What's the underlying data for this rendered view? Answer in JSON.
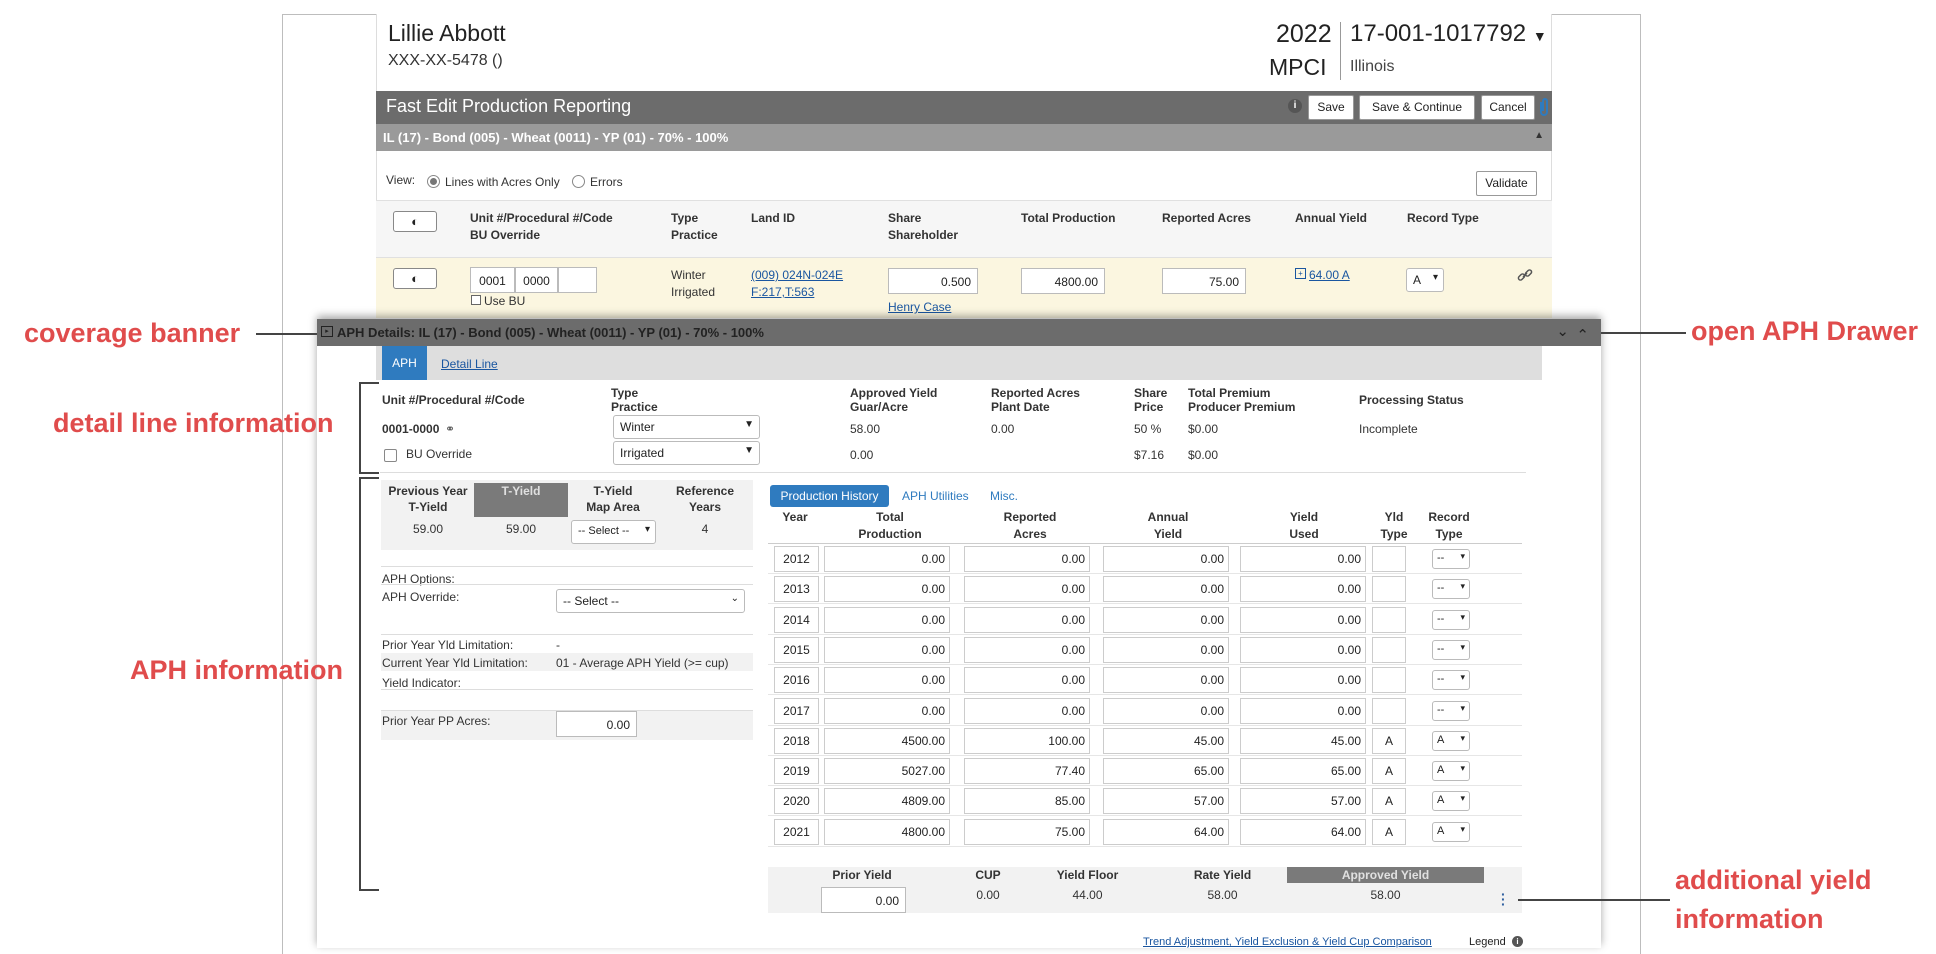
{
  "header": {
    "name": "Lillie Abbott",
    "ssn": "XXX-XX-5478 ()",
    "year": "2022",
    "program": "MPCI",
    "policy": "17-001-1017792",
    "state": "Illinois"
  },
  "toolbar": {
    "title": "Fast Edit Production Reporting",
    "save": "Save",
    "save_continue": "Save & Continue",
    "cancel": "Cancel"
  },
  "coverage": "IL (17) - Bond (005) - Wheat (0011) - YP (01) - 70% - 100%",
  "view": {
    "label": "View:",
    "opt1": "Lines with Acres Only",
    "opt2": "Errors",
    "validate": "Validate"
  },
  "table": {
    "headers": {
      "unit": "Unit #/Procedural #/Code",
      "bu": "BU Override",
      "type": "Type",
      "practice": "Practice",
      "land": "Land ID",
      "share": "Share",
      "shareholder": "Shareholder",
      "total": "Total Production",
      "acres": "Reported Acres",
      "annual": "Annual Yield",
      "record": "Record Type"
    },
    "row": {
      "unit": "0001",
      "proc": "0000",
      "use_bu": "Use BU",
      "type": "Winter",
      "practice": "Irrigated",
      "land1": "(009) 024N-024E",
      "land2": "F:217,T:563",
      "share": "0.500",
      "shareholder": "Henry Case",
      "total": "4800.00",
      "acres": "75.00",
      "annual": "64.00 A",
      "record": "A"
    }
  },
  "drawer": {
    "title": "APH Details: IL (17) - Bond (005) - Wheat (0011) - YP (01) - 70% - 100%",
    "tabs": [
      "APH",
      "Detail Line"
    ],
    "detail": {
      "h_unit": "Unit #/Procedural #/Code",
      "h_type": "Type",
      "h_practice": "Practice",
      "h_approved": "Approved Yield",
      "h_guar": "Guar/Acre",
      "h_racres": "Reported Acres",
      "h_plant": "Plant Date",
      "h_share": "Share",
      "h_price": "Price",
      "h_tprem": "Total Premium",
      "h_pprem": "Producer Premium",
      "h_status": "Processing Status",
      "unit": "0001-0000",
      "bu": "BU Override",
      "type": "Winter",
      "practice": "Irrigated",
      "approved": "58.00",
      "guar": "0.00",
      "racres": "0.00",
      "share": "50 %",
      "price": "$7.16",
      "tprem": "$0.00",
      "pprem": "$0.00",
      "status": "Incomplete"
    },
    "aph": {
      "h_prev": "Previous Year",
      "h_prev2": "T-Yield",
      "h_tyield": "T-Yield",
      "h_map": "T-Yield",
      "h_map2": "Map Area",
      "h_ref": "Reference",
      "h_ref2": "Years",
      "prev": "59.00",
      "tyield": "59.00",
      "map": "-- Select --",
      "ref": "4",
      "options": "APH Options:",
      "override": "APH Override:",
      "override_val": "-- Select --",
      "prior_lim": "Prior Year Yld Limitation:",
      "prior_lim_val": "-",
      "cur_lim": "Current Year Yld Limitation:",
      "cur_lim_val": "01 - Average APH Yield (>= cup)",
      "indicator": "Yield Indicator:",
      "pp_acres": "Prior Year PP Acres:",
      "pp_val": "0.00"
    },
    "history": {
      "tabs": [
        "Production History",
        "APH Utilities",
        "Misc."
      ],
      "headers": {
        "year": "Year",
        "total": "Total",
        "total2": "Production",
        "rep": "Reported",
        "rep2": "Acres",
        "annual": "Annual",
        "annual2": "Yield",
        "used": "Yield",
        "used2": "Used",
        "ytype": "Yld",
        "ytype2": "Type",
        "rtype": "Record",
        "rtype2": "Type"
      },
      "rows": [
        {
          "year": "2012",
          "total": "0.00",
          "acres": "0.00",
          "annual": "0.00",
          "used": "0.00",
          "ytype": "",
          "rtype": "--"
        },
        {
          "year": "2013",
          "total": "0.00",
          "acres": "0.00",
          "annual": "0.00",
          "used": "0.00",
          "ytype": "",
          "rtype": "--"
        },
        {
          "year": "2014",
          "total": "0.00",
          "acres": "0.00",
          "annual": "0.00",
          "used": "0.00",
          "ytype": "",
          "rtype": "--"
        },
        {
          "year": "2015",
          "total": "0.00",
          "acres": "0.00",
          "annual": "0.00",
          "used": "0.00",
          "ytype": "",
          "rtype": "--"
        },
        {
          "year": "2016",
          "total": "0.00",
          "acres": "0.00",
          "annual": "0.00",
          "used": "0.00",
          "ytype": "",
          "rtype": "--"
        },
        {
          "year": "2017",
          "total": "0.00",
          "acres": "0.00",
          "annual": "0.00",
          "used": "0.00",
          "ytype": "",
          "rtype": "--"
        },
        {
          "year": "2018",
          "total": "4500.00",
          "acres": "100.00",
          "annual": "45.00",
          "used": "45.00",
          "ytype": "A",
          "rtype": "A"
        },
        {
          "year": "2019",
          "total": "5027.00",
          "acres": "77.40",
          "annual": "65.00",
          "used": "65.00",
          "ytype": "A",
          "rtype": "A"
        },
        {
          "year": "2020",
          "total": "4809.00",
          "acres": "85.00",
          "annual": "57.00",
          "used": "57.00",
          "ytype": "A",
          "rtype": "A"
        },
        {
          "year": "2021",
          "total": "4800.00",
          "acres": "75.00",
          "annual": "64.00",
          "used": "64.00",
          "ytype": "A",
          "rtype": "A"
        }
      ]
    },
    "summary": {
      "h_prior": "Prior Yield",
      "h_cup": "CUP",
      "h_floor": "Yield Floor",
      "h_rate": "Rate Yield",
      "h_approved": "Approved Yield",
      "prior": "0.00",
      "cup": "0.00",
      "floor": "44.00",
      "rate": "58.00",
      "approved": "58.00"
    },
    "footer_link": "Trend Adjustment, Yield Exclusion & Yield Cup Comparison",
    "legend": "Legend"
  },
  "annotations": {
    "coverage": "coverage banner",
    "detail": "detail line information",
    "aph": "APH information",
    "open": "open APH Drawer",
    "additional1": "additional yield",
    "additional2": "information"
  }
}
